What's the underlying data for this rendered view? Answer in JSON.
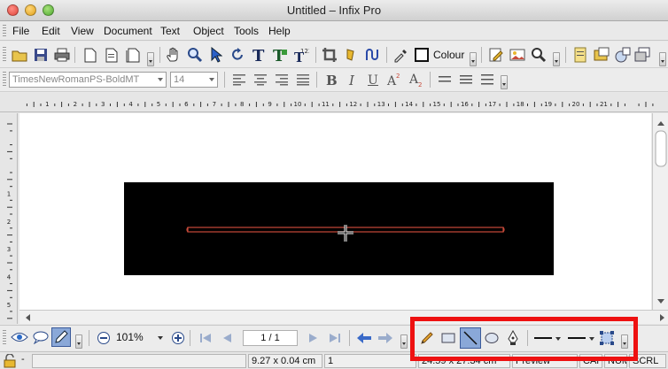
{
  "window": {
    "title": "Untitled – Infix Pro"
  },
  "menu": [
    "File",
    "Edit",
    "View",
    "Document",
    "Text",
    "Object",
    "Tools",
    "Help"
  ],
  "toolbar": {
    "colour_label": "Colour"
  },
  "format": {
    "font_name": "TimesNewRomanPS-BoldMT",
    "font_size": "14"
  },
  "ruler_numbers": [
    "1",
    "2",
    "3",
    "4",
    "5",
    "6",
    "7",
    "8",
    "9",
    "10",
    "11",
    "12",
    "13",
    "14",
    "15",
    "16",
    "17",
    "18",
    "19",
    "20",
    "21"
  ],
  "vruler_numbers": [
    "1",
    "2",
    "3",
    "4",
    "5",
    "6"
  ],
  "bottom": {
    "zoom": "101%",
    "page": "1 / 1"
  },
  "status": {
    "size": "9.27 x 0.04 cm",
    "page_num": "1",
    "pos": "24.59 x 27.34 cm",
    "mode": "Preview",
    "caps": "CAP",
    "num": "NUM",
    "scrl": "SCRL"
  },
  "colors": {
    "highlight": "#ee1111",
    "selection": "#c84a3a",
    "canvas_bg": "#000000"
  }
}
